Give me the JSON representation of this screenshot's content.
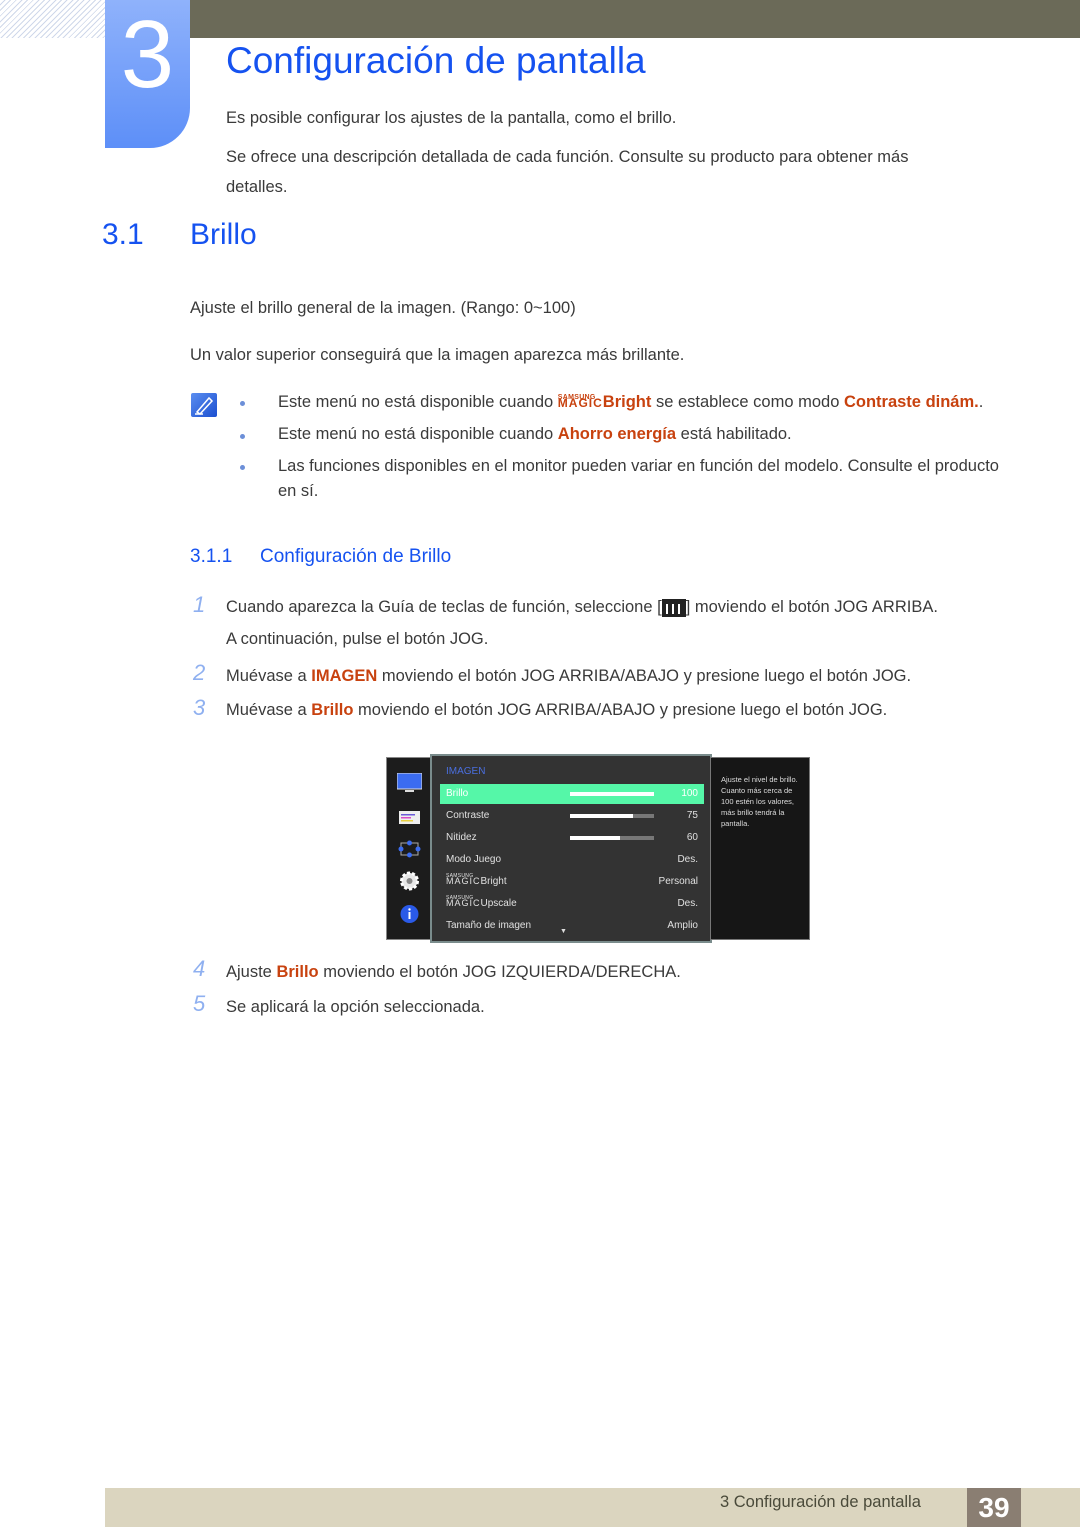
{
  "chapter": {
    "number": "3",
    "title": "Configuración de pantalla",
    "intro": [
      "Es posible configurar los ajustes de la pantalla, como el brillo.",
      "Se ofrece una descripción detallada de cada función. Consulte su producto para obtener más",
      "detalles."
    ]
  },
  "section": {
    "number": "3.1",
    "title": "Brillo",
    "paragraphs": [
      "Ajuste el brillo general de la imagen. (Rango: 0~100)",
      "Un valor superior conseguirá que la imagen aparezca más brillante."
    ]
  },
  "notes": [
    {
      "pre": "Este menú no está disponible cuando ",
      "magic_top": "SAMSUNG",
      "magic_bottom": "MAGIC",
      "magic_word": "Bright",
      "mid": " se establece como modo ",
      "highlight": "Contraste dinám.",
      "post": "."
    },
    {
      "pre": "Este menú no está disponible cuando ",
      "highlight": "Ahorro energía",
      "post": " está habilitado."
    },
    {
      "line1": "Las funciones disponibles en el monitor pueden variar en función del modelo. Consulte el producto",
      "line2": "en sí."
    }
  ],
  "subsection": {
    "number": "3.1.1",
    "title": "Configuración de Brillo"
  },
  "steps": [
    {
      "num": "1",
      "pre": "Cuando aparezca la Guía de teclas de función, seleccione [",
      "post": "] moviendo el botón JOG ARRIBA.",
      "line2": "A continuación, pulse el botón JOG."
    },
    {
      "num": "2",
      "pre": "Muévase a ",
      "highlight": "IMAGEN",
      "post": " moviendo el botón JOG ARRIBA/ABAJO y presione luego el botón JOG."
    },
    {
      "num": "3",
      "pre": "Muévase a ",
      "highlight": "Brillo",
      "post": " moviendo el botón JOG ARRIBA/ABAJO y presione luego el botón JOG."
    },
    {
      "num": "4",
      "pre": "Ajuste ",
      "highlight": "Brillo",
      "post": " moviendo el botón JOG IZQUIERDA/DERECHA."
    },
    {
      "num": "5",
      "pre": "Se aplicará la opción seleccionada."
    }
  ],
  "osd": {
    "title": "IMAGEN",
    "rows": [
      {
        "label": "Brillo",
        "value": "100",
        "bar": 1.0,
        "selected": true
      },
      {
        "label": "Contraste",
        "value": "75",
        "bar": 0.75
      },
      {
        "label": "Nitidez",
        "value": "60",
        "bar": 0.6
      },
      {
        "label": "Modo Juego",
        "value": "Des."
      },
      {
        "label": "Bright",
        "value": "Personal",
        "magic": true
      },
      {
        "label": "Upscale",
        "value": "Des.",
        "magic": true
      },
      {
        "label": "Tamaño de imagen",
        "value": "Amplio"
      }
    ],
    "magic_top": "SAMSUNG",
    "magic_bottom": "MAGIC",
    "help": "Ajuste el nivel de brillo. Cuanto más cerca de 100 estén los valores, más brillo tendrá la pantalla.",
    "icons": [
      "monitor-icon",
      "picture-settings-icon",
      "size-position-icon",
      "gear-icon",
      "info-icon"
    ],
    "more_indicator": "▼"
  },
  "footer": {
    "text": "3 Configuración de pantalla",
    "page": "39"
  },
  "colors": {
    "accent": "#1552f0",
    "highlight": "#c8420f",
    "osd_selected": "#55f7a8"
  }
}
